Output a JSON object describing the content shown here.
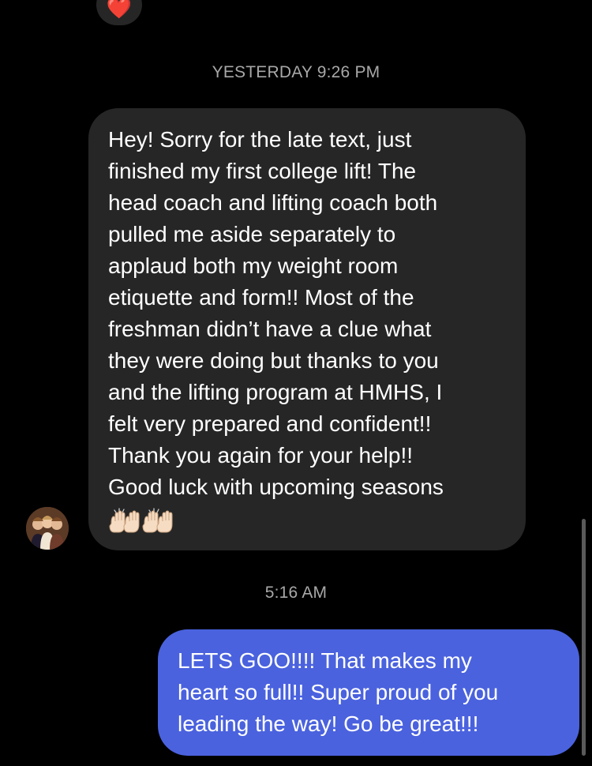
{
  "reaction": {
    "emoji": "❤️"
  },
  "timestamps": {
    "first": "YESTERDAY 9:26 PM",
    "second": "5:16 AM"
  },
  "incoming_message": {
    "text": "Hey! Sorry for the late text, just\nfinished my first college lift! The\nhead coach and lifting coach both\npulled me aside separately to\napplaud both my weight room\netiquette and form!! Most of the\nfreshman didn’t have a clue what\nthey were doing but thanks to you\nand the lifting program at HMHS, I\nfelt very prepared and confident!!\nThank you again for your help!!\nGood luck with upcoming seasons",
    "emojis": "🙌🏻🙌🏻",
    "bubble_color": "#262626",
    "sender_avatar": "avatar"
  },
  "outgoing_message": {
    "text": "LETS GOO!!!! That makes my\nheart so full!! Super proud of you\nleading the way! Go be great!!!",
    "bubble_color": "#4a62de"
  },
  "colors": {
    "background": "#000000",
    "timestamp": "#a8a8a8",
    "text": "#ffffff"
  }
}
